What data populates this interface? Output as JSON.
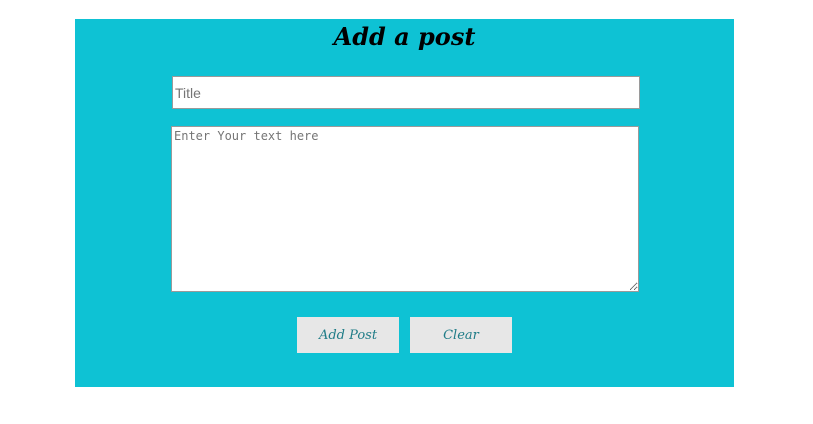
{
  "form": {
    "heading": "Add a post",
    "title_placeholder": "Title",
    "title_value": "",
    "text_placeholder": "Enter Your text here",
    "text_value": "",
    "add_label": "Add Post",
    "clear_label": "Clear"
  },
  "colors": {
    "panel_background": "#0ec2d4",
    "button_background": "#e7e7e7",
    "button_text": "#1f7c87"
  }
}
